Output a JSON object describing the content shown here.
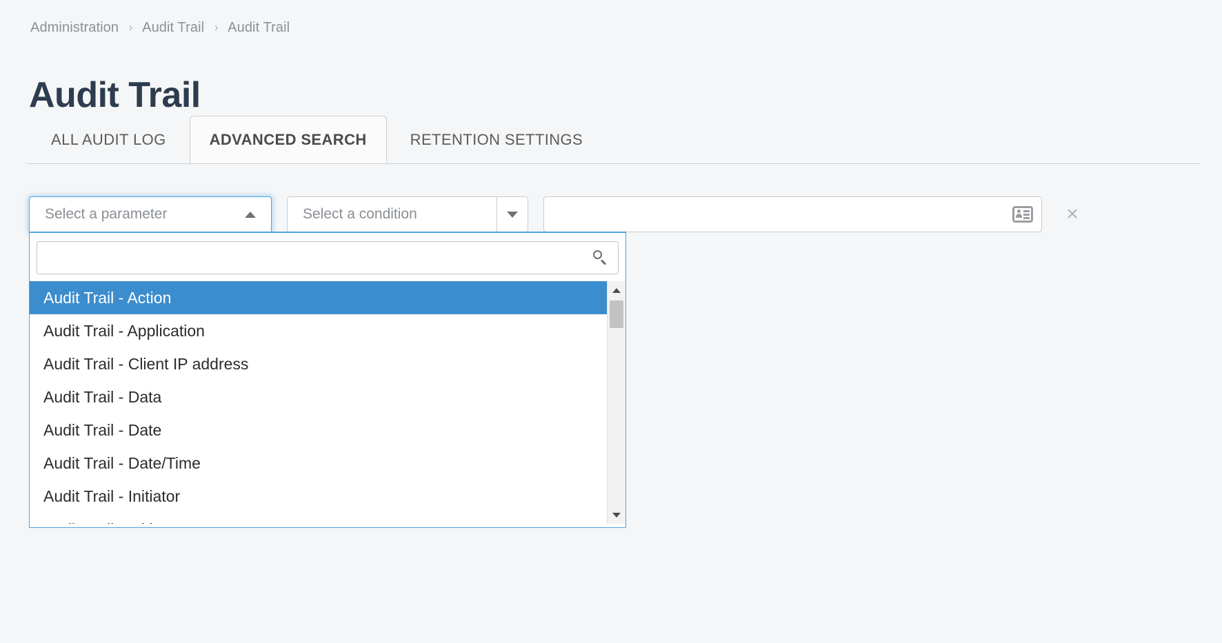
{
  "breadcrumb": {
    "items": [
      "Administration",
      "Audit Trail",
      "Audit Trail"
    ],
    "separator": "›"
  },
  "page": {
    "title": "Audit Trail"
  },
  "tabs": [
    {
      "label": "ALL AUDIT LOG",
      "active": false
    },
    {
      "label": "ADVANCED SEARCH",
      "active": true
    },
    {
      "label": "RETENTION SETTINGS",
      "active": false
    }
  ],
  "filter_row": {
    "parameter_select": {
      "placeholder": "Select a parameter",
      "value": "",
      "state": "open",
      "caret": "caret-up"
    },
    "condition_select": {
      "placeholder": "Select a condition",
      "value": "",
      "caret": "caret-down"
    },
    "value_field": {
      "placeholder": "",
      "value": "",
      "icon": "contact-card-icon"
    },
    "remove_button": {
      "label": "×",
      "icon": "close-icon"
    }
  },
  "dropdown": {
    "search": {
      "value": "",
      "placeholder": "",
      "icon": "search-icon"
    },
    "options": [
      {
        "label": "Audit Trail - Action",
        "selected": true
      },
      {
        "label": "Audit Trail - Application",
        "selected": false
      },
      {
        "label": "Audit Trail - Client IP address",
        "selected": false
      },
      {
        "label": "Audit Trail - Data",
        "selected": false
      },
      {
        "label": "Audit Trail - Date",
        "selected": false
      },
      {
        "label": "Audit Trail - Date/Time",
        "selected": false
      },
      {
        "label": "Audit Trail - Initiator",
        "selected": false
      },
      {
        "label": "Audit Trail - Initiator Name",
        "selected": false
      }
    ],
    "scrollbar": {
      "up_icon": "scroll-up-arrow-icon",
      "down_icon": "scroll-down-arrow-icon"
    }
  },
  "colors": {
    "accent_blue": "#3c8dcd",
    "focus_blue": "#4fa3e3",
    "title_navy": "#2d3c4e",
    "page_bg": "#f5f6f7"
  }
}
